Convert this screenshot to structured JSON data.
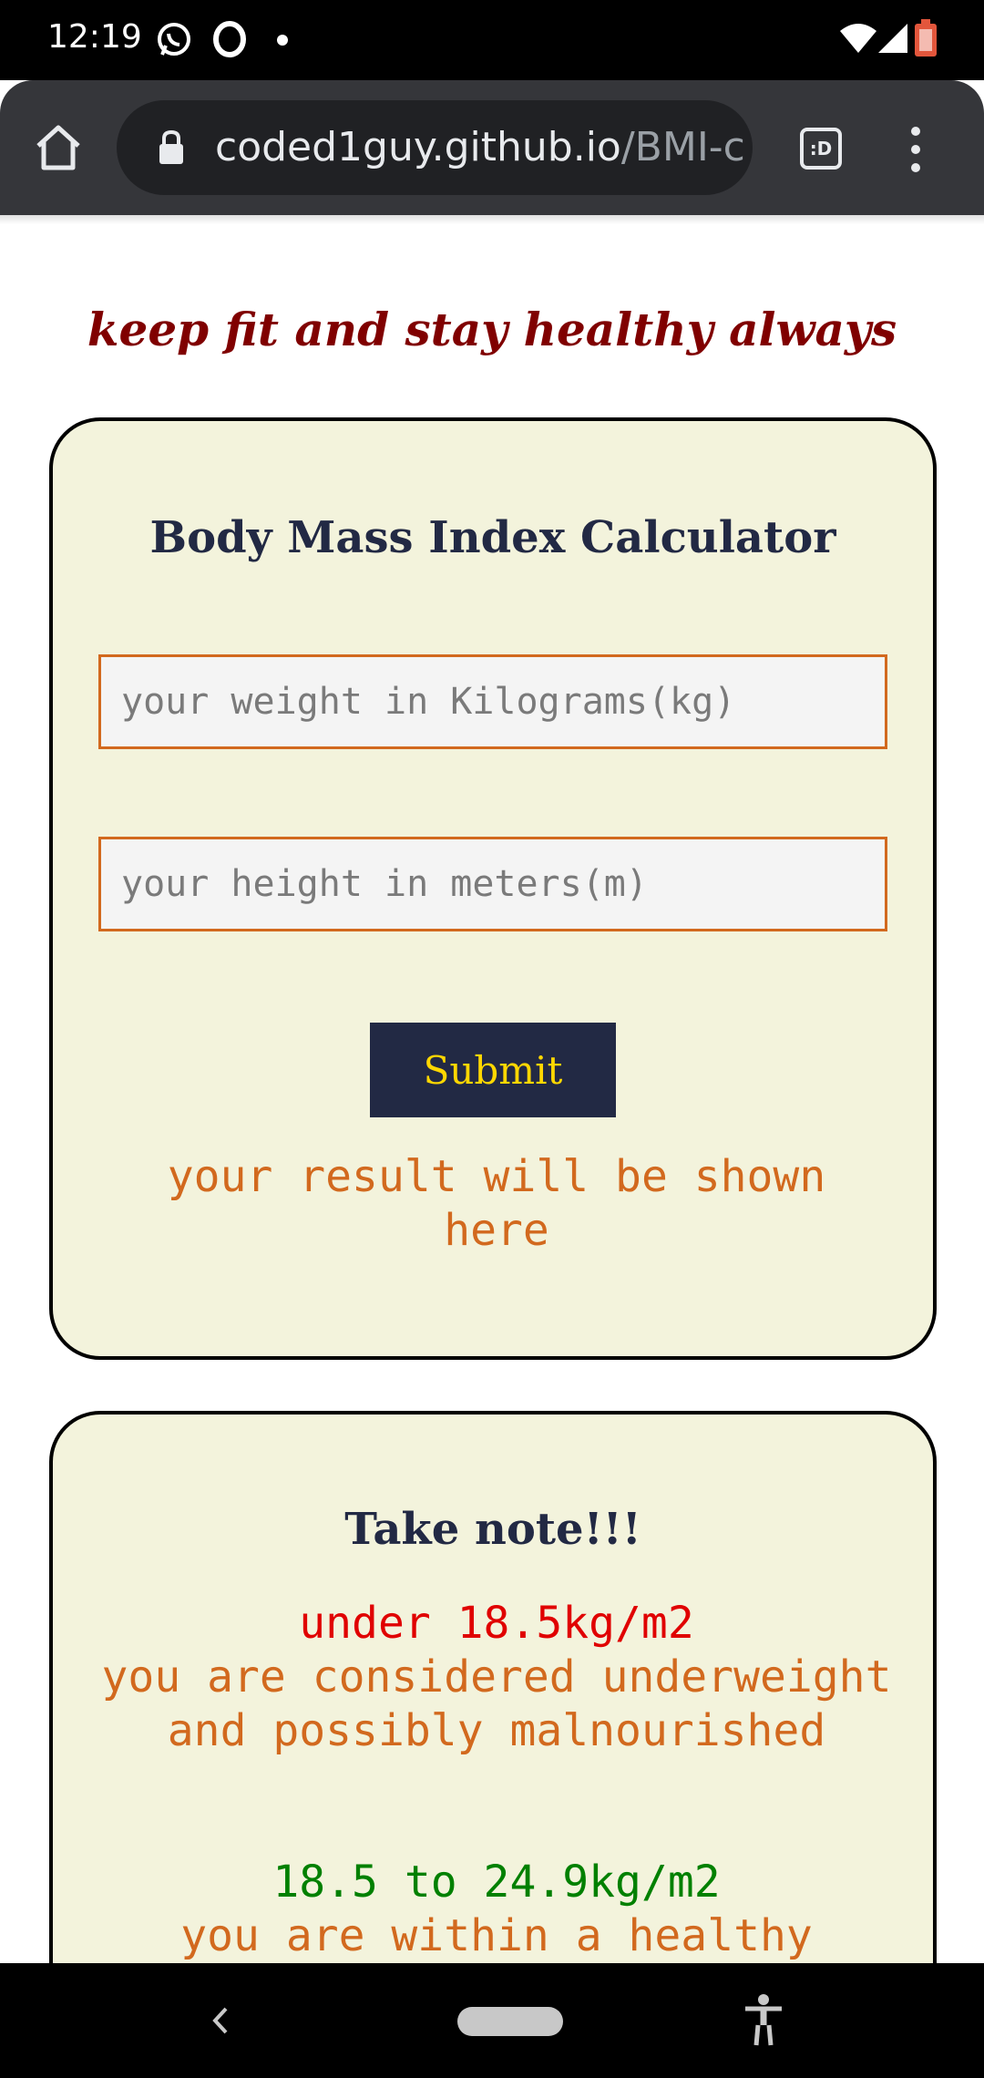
{
  "status_bar": {
    "time": "12:19",
    "icons": [
      "whatsapp-icon",
      "opera-icon",
      "notification-dot",
      "wifi-icon",
      "signal-icon",
      "battery-icon"
    ]
  },
  "browser": {
    "url_host": "coded1guy.github.io",
    "url_path": "/BMI-c",
    "tab_switcher_label": ":D",
    "icons": [
      "home-icon",
      "lock-icon",
      "tab-switcher-icon",
      "more-menu-icon"
    ]
  },
  "page": {
    "motto": "keep fit and stay healthy always",
    "calculator": {
      "title": "Body Mass Index Calculator",
      "weight_placeholder": "your weight in Kilograms(kg)",
      "height_placeholder": "your height in meters(m)",
      "submit_label": "Submit",
      "result_text": "your result will be shown here"
    },
    "notes": {
      "title": "Take note!!!",
      "items": [
        {
          "range": "under 18.5kg/m2",
          "description": "you are considered underweight and possibly malnourished",
          "color": "#e00000"
        },
        {
          "range": "18.5 to 24.9kg/m2",
          "description": "you are within a healthy",
          "color": "#008000"
        }
      ]
    }
  },
  "colors": {
    "motto": "#800000",
    "card_bg": "#f3f3dc",
    "title": "#222944",
    "accent": "#d2691e",
    "button_text": "#ffd700"
  },
  "nav_bar": {
    "icons": [
      "back-icon",
      "home-pill-icon",
      "accessibility-icon"
    ]
  }
}
